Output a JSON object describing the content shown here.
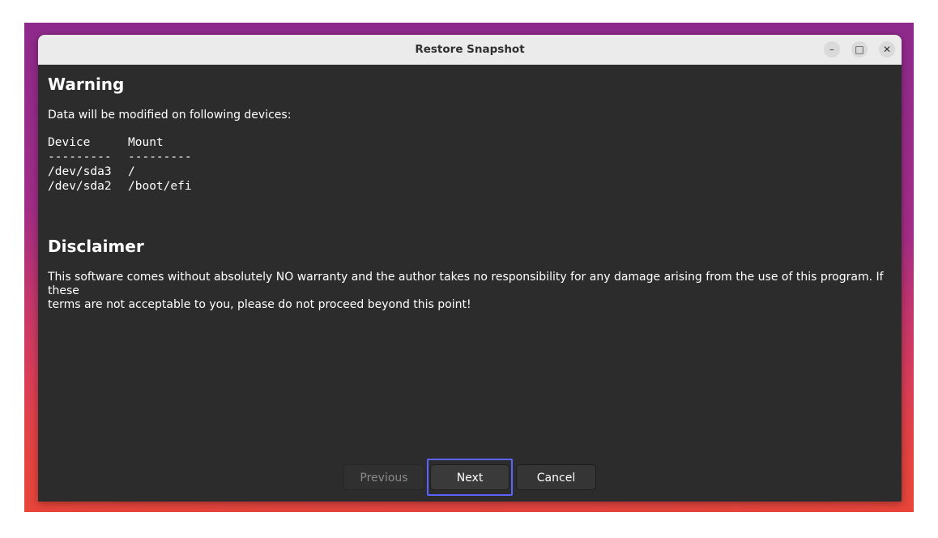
{
  "window": {
    "title": "Restore Snapshot",
    "controls": {
      "minimize": "–",
      "maximize": "□",
      "close": "✕"
    }
  },
  "warning": {
    "heading": "Warning",
    "intro": "Data will be modified on following devices:",
    "table": {
      "headers": [
        "Device",
        "Mount"
      ],
      "separator": [
        "---------",
        "---------"
      ],
      "rows": [
        [
          "/dev/sda3",
          "/"
        ],
        [
          "/dev/sda2",
          "/boot/efi"
        ]
      ]
    }
  },
  "disclaimer": {
    "heading": "Disclaimer",
    "text_line1": "This software comes without absolutely NO warranty and the author takes no responsibility for any damage arising from the use of this program. If these",
    "text_line2": "terms are not acceptable to you, please do not proceed beyond this point!"
  },
  "buttons": {
    "previous": "Previous",
    "next": "Next",
    "cancel": "Cancel"
  },
  "colors": {
    "window_bg": "#2c2c2c",
    "titlebar_bg": "#ebebeb",
    "focus_ring": "#5c62ff"
  }
}
